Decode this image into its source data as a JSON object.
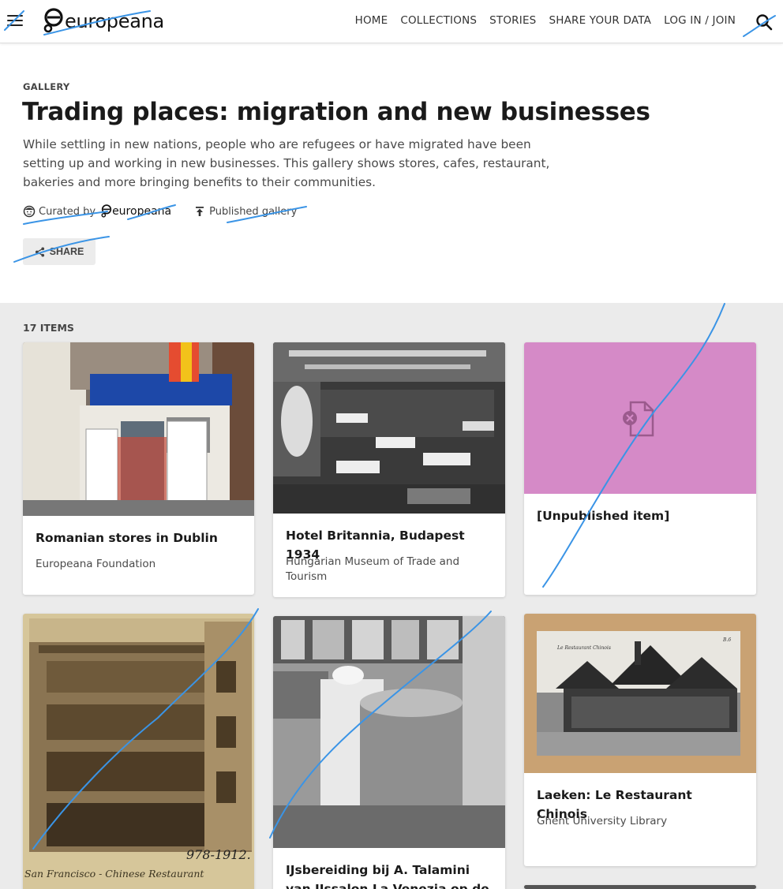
{
  "header": {
    "logo_text": "europeana",
    "menu_icon": "hamburger-menu-icon",
    "nav": [
      "HOME",
      "COLLECTIONS",
      "STORIES",
      "SHARE YOUR DATA",
      "LOG IN / JOIN"
    ],
    "search_icon": "search-icon"
  },
  "hero": {
    "kicker": "GALLERY",
    "title": "Trading places: migration and new businesses",
    "description": "While settling in new nations, people who are refugees or have migrated have been setting up and working in new businesses. This gallery shows stores, cafes, restaurant, bakeries and more bringing benefits to their communities.",
    "curated_by_label": "Curated by",
    "curator": "europeana",
    "published_label": "Published gallery",
    "share_label": "SHARE"
  },
  "items": {
    "count_label": "17 ITEMS",
    "cards": [
      {
        "title": "Romanian stores in Dublin",
        "provider": "Europeana Foundation"
      },
      {
        "title": "Hotel Britannia, Budapest 1934",
        "provider": "Hungarian Museum of Trade and Tourism"
      },
      {
        "title": "[Unpublished item]",
        "provider": ""
      },
      {
        "title": "",
        "provider": "",
        "image_caption_1": "978-1912.",
        "image_caption_2": "San Francisco - Chinese Restaurant"
      },
      {
        "title": "IJsbereiding bij A. Talamini van IJssalon La Venezia op de",
        "provider": ""
      },
      {
        "title": "Laeken: Le Restaurant Chinois",
        "provider": "Ghent University Library",
        "image_caption_1": "Le Restaurant Chinois",
        "image_caption_2": "B.6"
      }
    ]
  },
  "colors": {
    "accent": "#1a1a1a",
    "section_bg": "#ebebeb",
    "placeholder_pink": "#d58ac7",
    "annotation_stroke": "#3a94e6"
  }
}
